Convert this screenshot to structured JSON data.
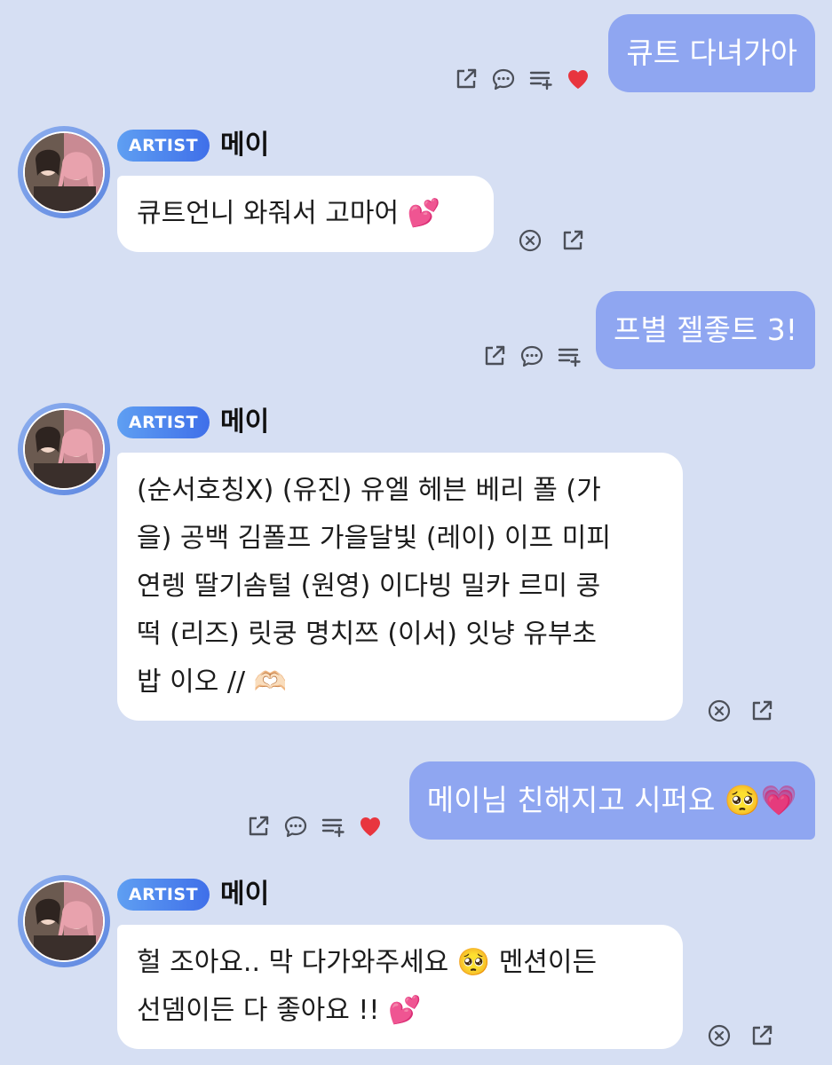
{
  "artist": {
    "badge": "ARTIST",
    "name": "메이"
  },
  "messages": [
    {
      "from": "user",
      "text": "큐트 다녀가아",
      "liked": true
    },
    {
      "from": "artist",
      "lines": [
        "큐트언니 와줘서 고마어 💕"
      ]
    },
    {
      "from": "user",
      "text": "프별 젤좋트 3!",
      "liked": false
    },
    {
      "from": "artist",
      "lines": [
        "(순서호칭X) (유진) 유엘 헤븐 베리 폴 (가",
        "을) 공백 김폴프 가을달빛 (레이) 이프 미피",
        "연렝 딸기솜털 (원영) 이다빙 밀카 르미 콩",
        "떡 (리즈) 릿쿵 명치쯔 (이서) 잇냥 유부초",
        "밥 이오 // 🫶🏻"
      ]
    },
    {
      "from": "user",
      "text": "메이님 친해지고 시퍼요 🥺💗",
      "liked": true
    },
    {
      "from": "artist",
      "lines": [
        "헐 조아요.. 막 다가와주세요 🥺 멘션이든",
        "선뎀이든 다 좋아요 !! 💕"
      ]
    }
  ],
  "icons": {
    "share": "share-icon",
    "reply": "reply-icon",
    "playlist_add": "playlist-add-icon",
    "heart": "heart-icon",
    "hide": "hide-icon"
  },
  "colors": {
    "background": "#d6dff3",
    "user_bubble": "#8fa6f1",
    "artist_bubble": "#ffffff",
    "heart": "#e8353e",
    "badge_start": "#5f9ff2",
    "badge_end": "#3f6fe9"
  }
}
